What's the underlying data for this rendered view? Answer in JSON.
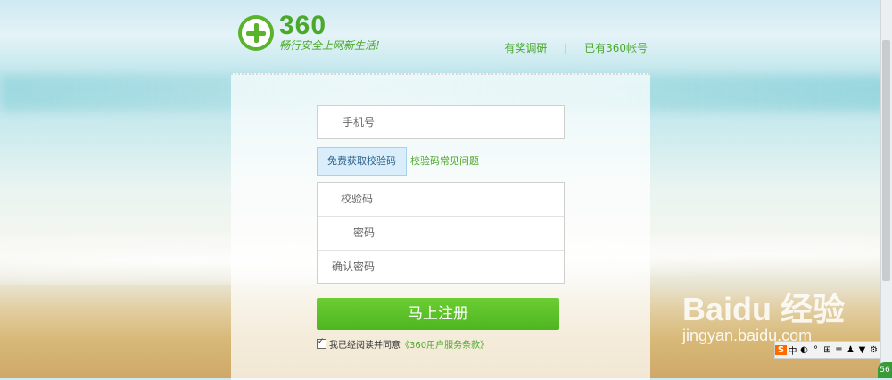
{
  "header": {
    "logo_number": "360",
    "logo_slogan": "畅行安全上网新生活!",
    "links": [
      "有奖调研",
      "已有360帐号"
    ],
    "separator": "|"
  },
  "form": {
    "phone_placeholder": "手机号",
    "get_code_button": "免费获取校验码",
    "code_faq_link": "校验码常见问题",
    "code_placeholder": "校验码",
    "password_placeholder": "密码",
    "confirm_password_placeholder": "确认密码",
    "submit_label": "马上注册",
    "agree_text": "我已经阅读并同意",
    "terms_link": "《360用户服务条款》",
    "agree_checked": true
  },
  "watermark": {
    "main": "Baidu 经验",
    "sub": "jingyan.baidu.com"
  },
  "toolbar": {
    "items": [
      "S",
      "中",
      "◐",
      "°",
      "⊞",
      "≡",
      "♟",
      "▼",
      "⚙"
    ],
    "corner": "56"
  },
  "colors": {
    "brand_green": "#4aa82a",
    "submit_green": "#5dc22a",
    "code_button_bg": "#d9eefa"
  }
}
